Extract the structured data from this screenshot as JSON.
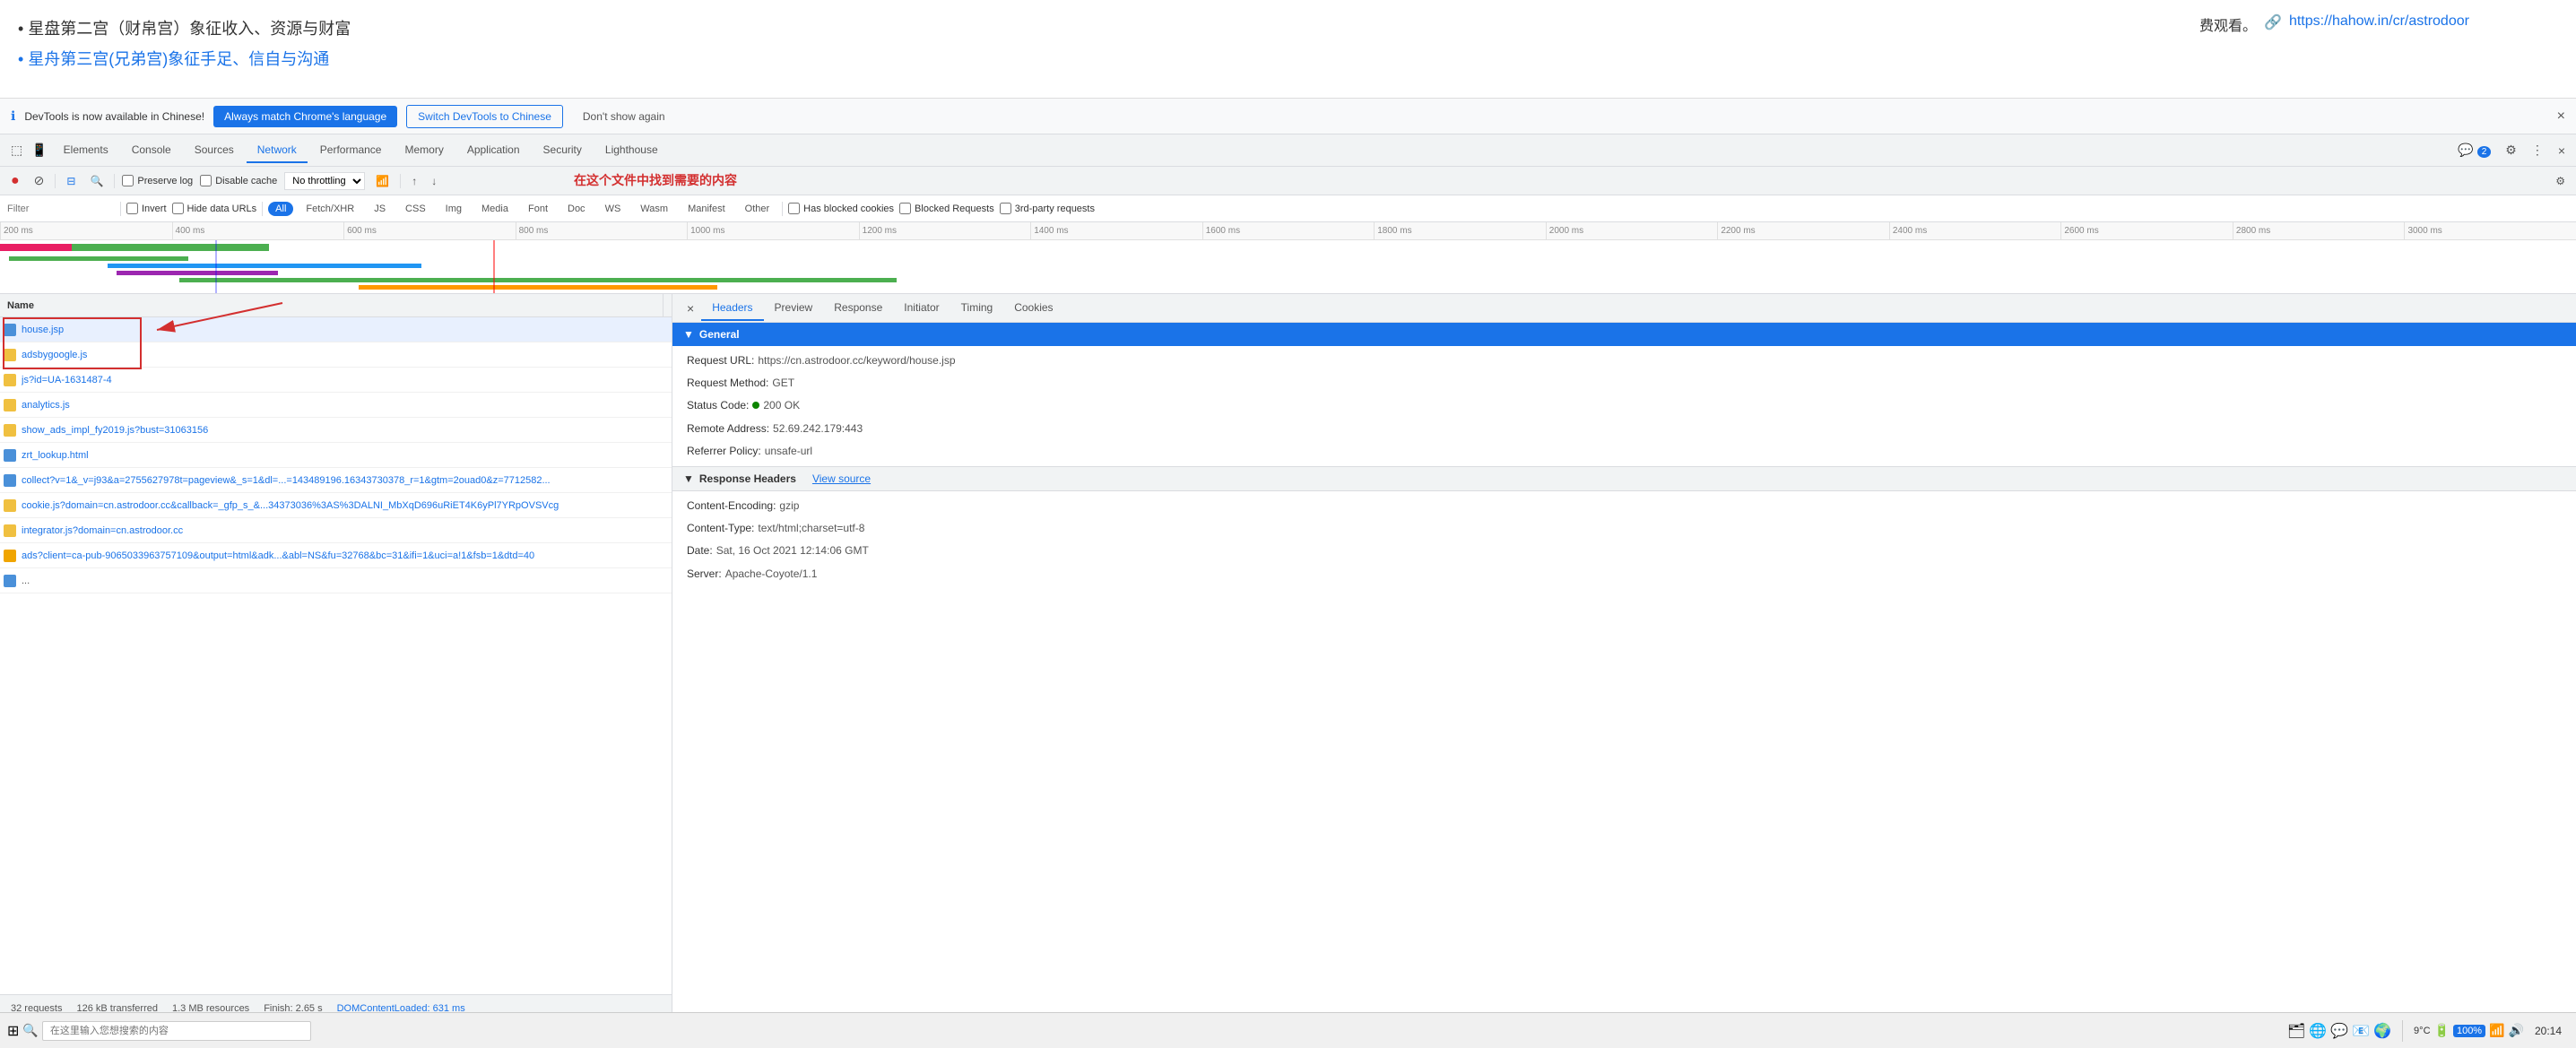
{
  "page": {
    "chinese_text_1": "星盘第二宫（财帛宫）象征收入、资源与财富",
    "chinese_text_2": "星舟第三宫(兄弟宫)象征手足、信自与沟通",
    "chinese_right_text": "费观看。",
    "page_url": "https://hahow.in/cr/astrodoor"
  },
  "notification": {
    "icon": "ℹ",
    "text": "DevTools is now available in Chinese!",
    "btn1": "Always match Chrome's language",
    "btn2": "Switch DevTools to Chinese",
    "btn3": "Don't show again",
    "close": "×"
  },
  "devtools_tabs": {
    "items": [
      "Elements",
      "Console",
      "Sources",
      "Network",
      "Performance",
      "Memory",
      "Application",
      "Security",
      "Lighthouse"
    ],
    "active": "Network",
    "badge": "2",
    "settings_icon": "⚙",
    "more_icon": "⋮",
    "close_icon": "×"
  },
  "network_toolbar": {
    "record_icon": "●",
    "clear_icon": "⊘",
    "filter_icon": "⊟",
    "search_icon": "🔍",
    "preserve_log": "Preserve log",
    "disable_cache": "Disable cache",
    "throttling": "No throttling",
    "online_icon": "📶",
    "import_icon": "↑",
    "export_icon": "↓",
    "annotation": "在这个文件中找到需要的内容",
    "settings_icon": "⚙"
  },
  "filter_bar": {
    "placeholder": "Filter",
    "invert": "Invert",
    "hide_data_urls": "Hide data URLs",
    "buttons": [
      "All",
      "Fetch/XHR",
      "JS",
      "CSS",
      "Img",
      "Media",
      "Font",
      "Doc",
      "WS",
      "Wasm",
      "Manifest",
      "Other"
    ],
    "active_btn": "All",
    "has_blocked": "Has blocked cookies",
    "blocked_requests": "Blocked Requests",
    "third_party": "3rd-party requests"
  },
  "timeline": {
    "ticks": [
      "200 ms",
      "400 ms",
      "600 ms",
      "800 ms",
      "1000 ms",
      "1200 ms",
      "1400 ms",
      "1600 ms",
      "1800 ms",
      "2000 ms",
      "2200 ms",
      "2400 ms",
      "2600 ms",
      "2800 ms",
      "3000 ms"
    ]
  },
  "requests": {
    "header": "Name",
    "items": [
      {
        "name": "house.jsp",
        "selected": true
      },
      {
        "name": "adsbygoogle.js",
        "selected": false
      },
      {
        "name": "js?id=UA-1631487-4",
        "selected": false
      },
      {
        "name": "analytics.js",
        "selected": false
      },
      {
        "name": "show_ads_impl_fy2019.js?bust=31063156",
        "selected": false
      },
      {
        "name": "zrt_lookup.html",
        "selected": false
      },
      {
        "name": "collect?v=1&_v=j93&a=2755627978t=pageview&_s=1&dl=...=143489196.16343730378_r=1&gtm=2ouad0&z=7712582...",
        "selected": false
      },
      {
        "name": "cookie.js?domain=cn.astrodoor.cc&callback=_gfp_s_&...34373036%3AS%3DALNI_MbXqD696uRiET4K6yPl7YRpOVSVcg",
        "selected": false
      },
      {
        "name": "integrator.js?domain=cn.astrodoor.cc",
        "selected": false
      },
      {
        "name": "ads?client=ca-pub-9065033963757109&output=html&adk...&abl=NS&fu=32768&bc=31&ifi=1&uci=a!1&fsb=1&dtd=40",
        "selected": false
      },
      {
        "name": "...(more items)",
        "selected": false
      }
    ]
  },
  "status_bar": {
    "requests_count": "32 requests",
    "transferred": "126 kB transferred",
    "resources": "1.3 MB resources",
    "finish": "Finish: 2.65 s",
    "dom_loaded": "DOMContentLoaded: 631 ms"
  },
  "headers_panel": {
    "close_icon": "×",
    "tabs": [
      "Headers",
      "Preview",
      "Response",
      "Initiator",
      "Timing",
      "Cookies"
    ],
    "active_tab": "Headers",
    "general_section": "▼ General",
    "general_items": [
      {
        "key": "Request URL:",
        "val": "https://cn.astrodoor.cc/keyword/house.jsp"
      },
      {
        "key": "Request Method:",
        "val": "GET"
      },
      {
        "key": "Status Code:",
        "val": "200 OK",
        "has_dot": true
      },
      {
        "key": "Remote Address:",
        "val": "52.69.242.179:443"
      },
      {
        "key": "Referrer Policy:",
        "val": "unsafe-url"
      }
    ],
    "response_section": "▼ Response Headers",
    "view_source": "View source",
    "response_items": [
      {
        "key": "Content-Encoding:",
        "val": "gzip"
      },
      {
        "key": "Content-Type:",
        "val": "text/html;charset=utf-8"
      },
      {
        "key": "Date:",
        "val": "Sat, 16 Oct 2021 12:14:06 GMT"
      },
      {
        "key": "Server:",
        "val": "Apache-Coyote/1.1"
      }
    ]
  },
  "taskbar": {
    "search_placeholder": "在这里输入您想搜索的内容",
    "time": "20:14",
    "battery": "9°C"
  }
}
